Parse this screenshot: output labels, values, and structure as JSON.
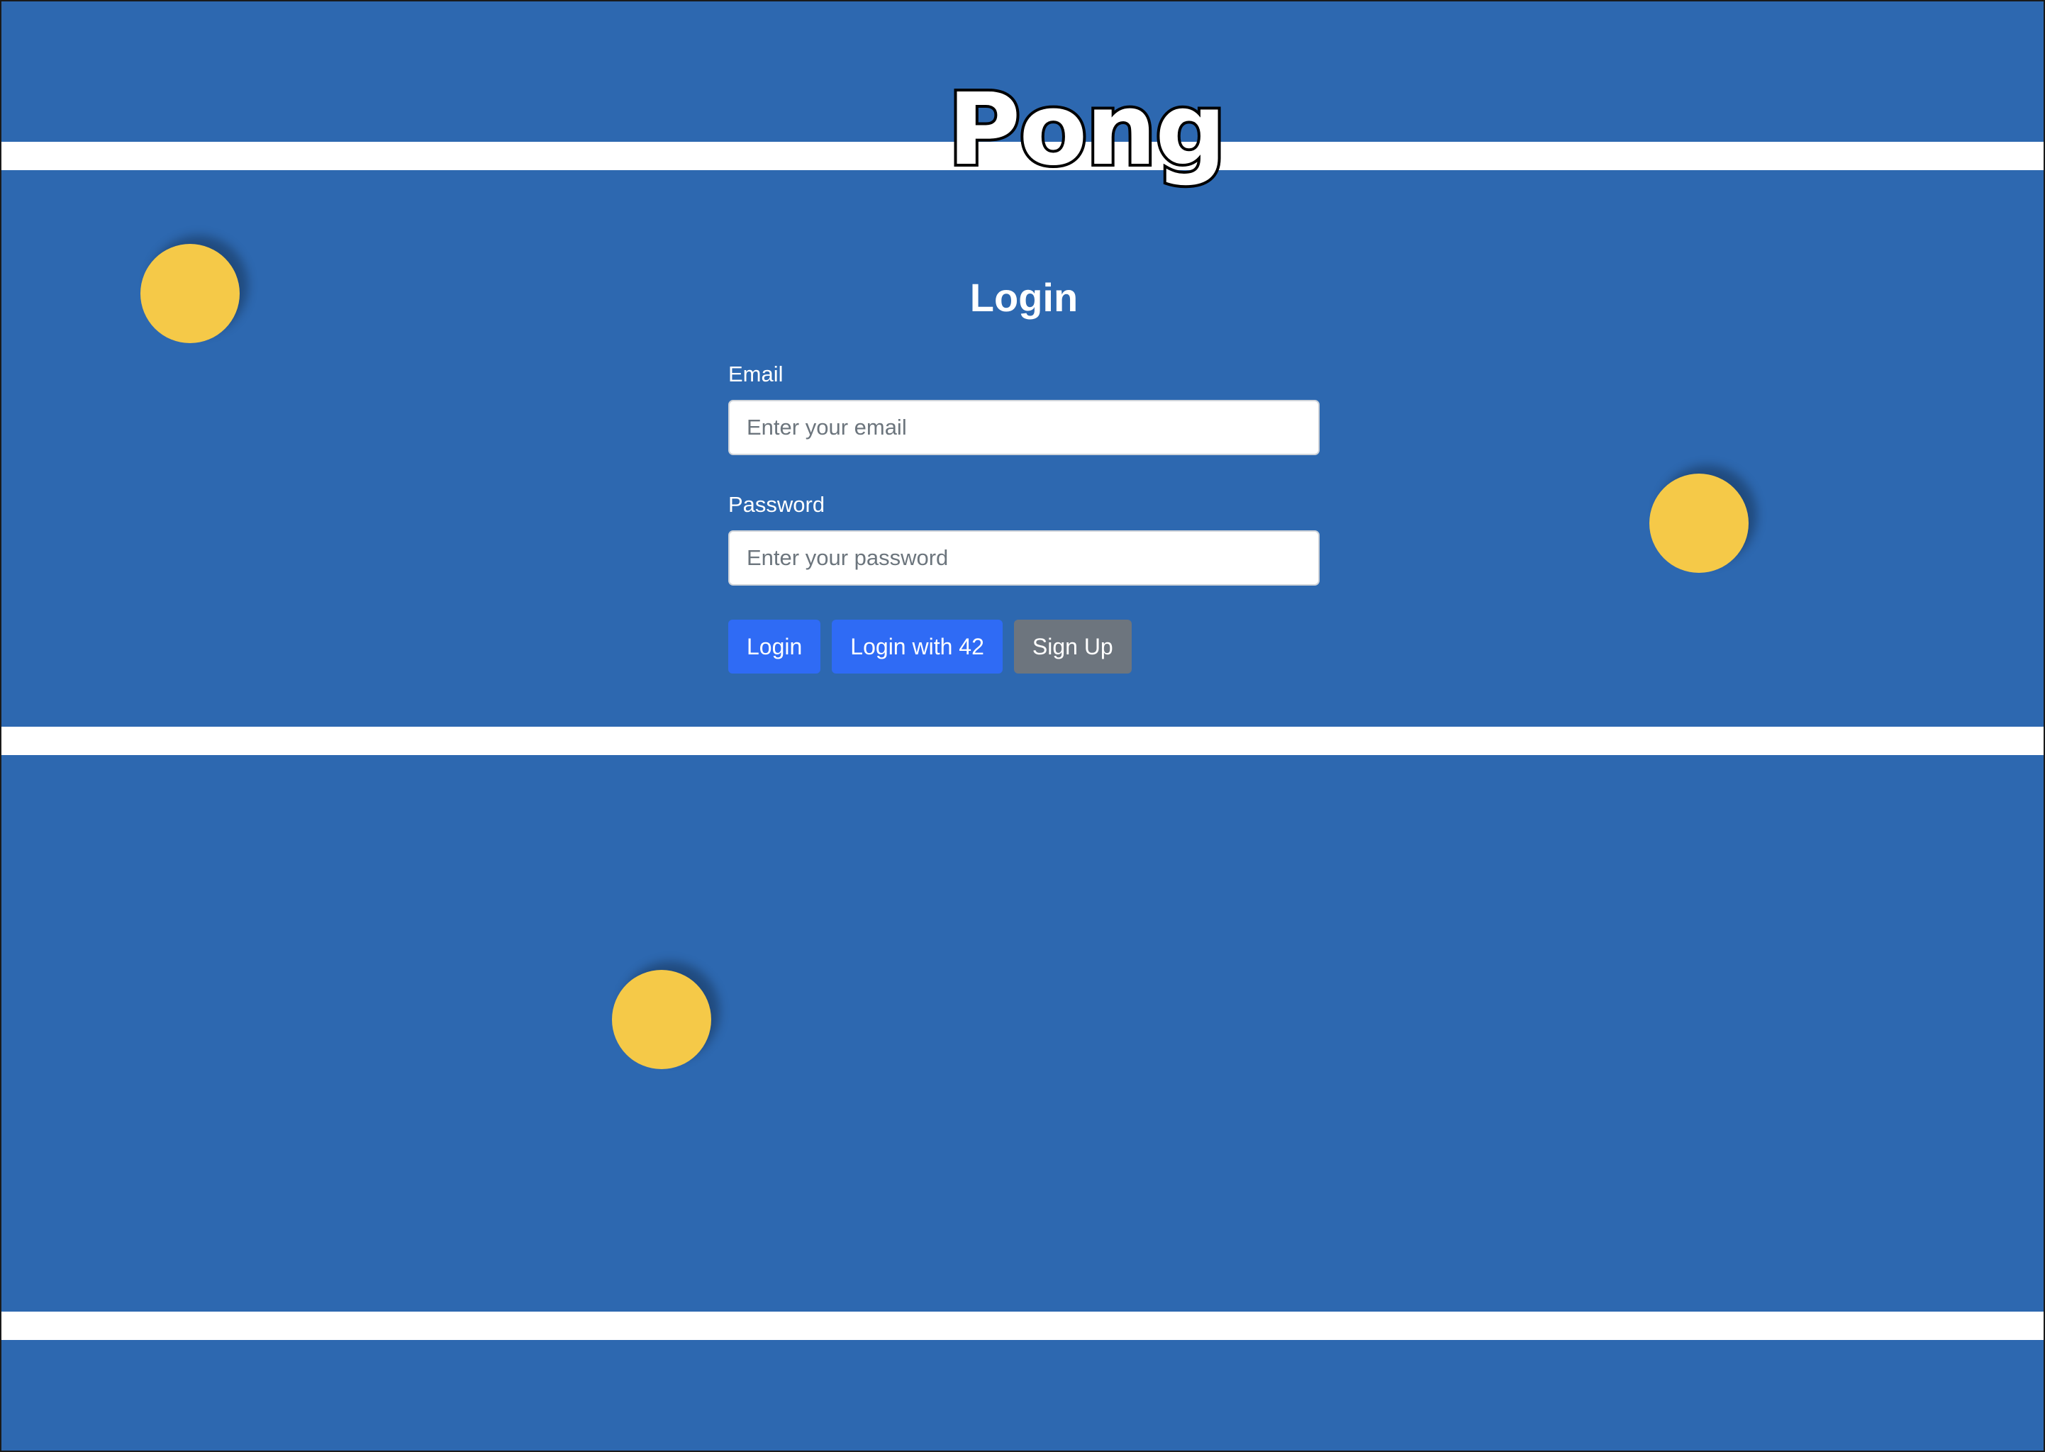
{
  "app": {
    "title": "Pong"
  },
  "login": {
    "heading": "Login",
    "email": {
      "label": "Email",
      "placeholder": "Enter your email",
      "value": ""
    },
    "password": {
      "label": "Password",
      "placeholder": "Enter your password",
      "value": ""
    },
    "buttons": {
      "login": "Login",
      "login_42": "Login with 42",
      "sign_up": "Sign Up"
    }
  },
  "colors": {
    "background": "#2d68b0",
    "court_line": "#ffffff",
    "ball": "#f5c948",
    "primary_button": "#2f6bf5",
    "secondary_button": "#6d757e"
  },
  "decorations": {
    "ball_icon": "ping-pong-ball",
    "court_lines": 3,
    "balls": 3
  }
}
